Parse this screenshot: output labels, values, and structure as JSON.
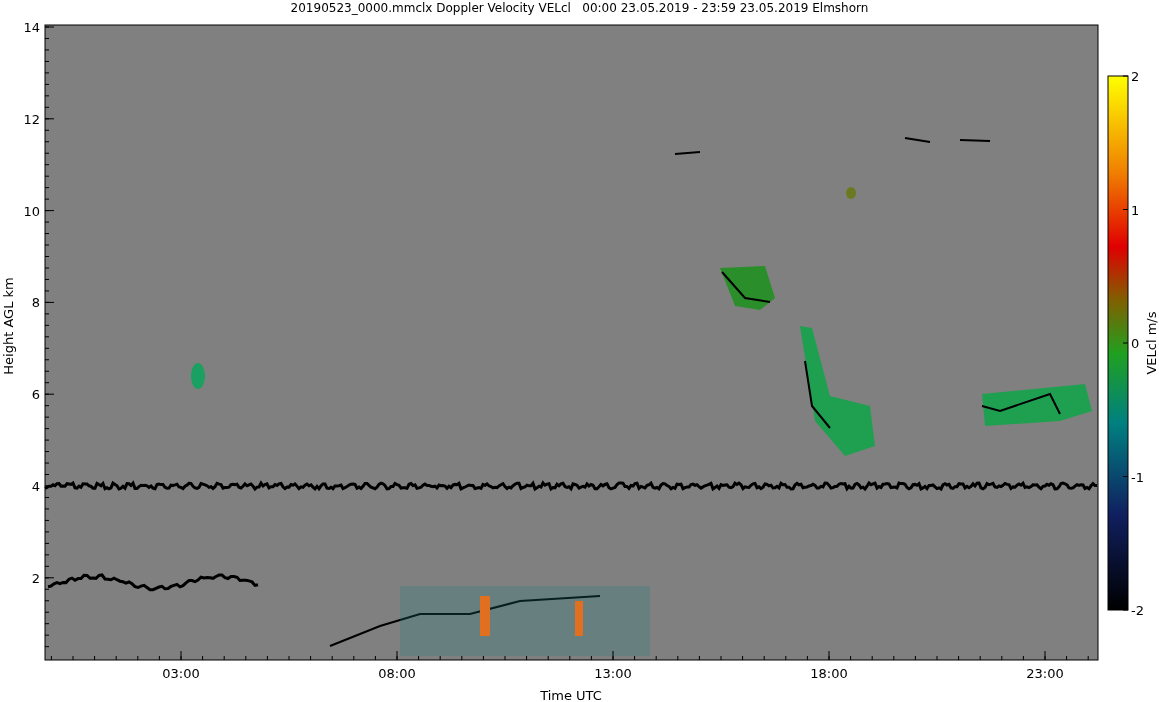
{
  "figure": {
    "title": "20190523_0000.mmclx Doppler Velocity VELcl   00:00 23.05.2019 - 23:59 23.05.2019 Elmshorn",
    "x_axis": {
      "label": "Time UTC",
      "ticks": [
        "03:00",
        "08:00",
        "13:00",
        "18:00",
        "23:00"
      ]
    },
    "y_axis": {
      "label": "Height AGL km",
      "ticks": [
        "14",
        "12",
        "10",
        "8",
        "6",
        "4",
        "2"
      ]
    },
    "colorbar": {
      "label": "VELcl m/s",
      "ticks": [
        "2",
        "1",
        "0",
        "-1",
        "-2"
      ]
    }
  }
}
